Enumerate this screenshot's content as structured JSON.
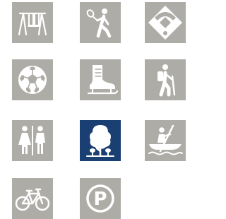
{
  "colors": {
    "tile_default": "#aeaca6",
    "tile_selected": "#1a3f73",
    "icon": "#ffffff",
    "page_background": "#ffffff"
  },
  "amenities": [
    {
      "icon": "swing-set-icon",
      "selected": false
    },
    {
      "icon": "tennis-player-icon",
      "selected": false
    },
    {
      "icon": "baseball-diamond-icon",
      "selected": false
    },
    {
      "icon": "soccer-ball-icon",
      "selected": false
    },
    {
      "icon": "ice-skate-icon",
      "selected": false
    },
    {
      "icon": "hiker-icon",
      "selected": false
    },
    {
      "icon": "restrooms-icon",
      "selected": false
    },
    {
      "icon": "trees-icon",
      "selected": true
    },
    {
      "icon": "canoe-icon",
      "selected": false
    },
    {
      "icon": "bicycle-icon",
      "selected": false
    },
    {
      "icon": "parking-icon",
      "selected": false
    }
  ],
  "labels": {
    "parking_letter": "P"
  }
}
